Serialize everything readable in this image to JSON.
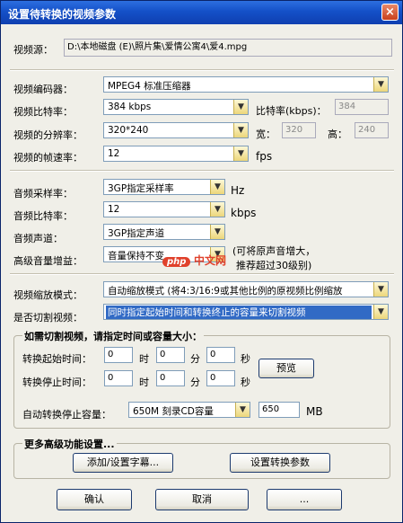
{
  "window": {
    "title": "设置待转换的视频参数",
    "close_label": "×"
  },
  "video": {
    "source_label": "视频源：",
    "source_value": "D:\\本地磁盘 (E)\\照片集\\爱情公寓4\\爱4.mpg",
    "encoder_label": "视频编码器：",
    "encoder_value": "MPEG4 标准压缩器",
    "bitrate_label": "视频比特率：",
    "bitrate_value": "384 kbps",
    "bitrate_kbps_label": "比特率(kbps)：",
    "bitrate_kbps_value": "384",
    "resolution_label": "视频的分辨率：",
    "resolution_value": "320*240",
    "width_label": "宽：",
    "width_value": "320",
    "height_label": "高：",
    "height_value": "240",
    "framerate_label": "视频的帧速率：",
    "framerate_value": "12",
    "framerate_unit": "fps"
  },
  "audio": {
    "samplerate_label": "音频采样率：",
    "samplerate_value": "3GP指定采样率",
    "samplerate_unit": "Hz",
    "bitrate_label": "音频比特率：",
    "bitrate_value": "12",
    "bitrate_unit": "kbps",
    "channel_label": "音频声道：",
    "channel_value": "3GP指定声道",
    "gain_label": "高级音量增益：",
    "gain_value": "音量保持不变",
    "gain_note_1": "(可将原声音增大，",
    "gain_note_2": "推荐超过30级别)"
  },
  "scale": {
    "label": "视频缩放模式：",
    "value": "自动缩放模式 (将4:3/16:9或其他比例的原视频比例缩放"
  },
  "cut": {
    "label": "是否切割视频：",
    "value": "同时指定起始时间和转换终止的容量来切割视频",
    "group_title": "如需切割视频，请指定时间或容量大小：",
    "start_label": "转换起始时间：",
    "stop_label": "转换停止时间：",
    "hour_unit": "时",
    "minute_unit": "分",
    "second_unit": "秒",
    "start_h": "0",
    "start_m": "0",
    "start_s": "0",
    "stop_h": "0",
    "stop_m": "0",
    "stop_s": "0",
    "preview_label": "预览",
    "capacity_label": "自动转换停止容量：",
    "capacity_value": "650M 刻录CD容量",
    "capacity_input": "650",
    "capacity_unit": "MB"
  },
  "advanced": {
    "group_title": "更多高级功能设置...",
    "subtitle_button": "添加/设置字幕...",
    "watermark_button": "设置转换参数"
  },
  "footer": {
    "ok_label": "确认",
    "cancel_label": "取消",
    "other_label": "..."
  },
  "watermark": {
    "logo_text": "php",
    "site_text": "中文网"
  },
  "colors": {
    "title_bar": "#1450c8",
    "selection_highlight": "#316ac5",
    "accent_orange": "#e0412b"
  },
  "icons": {
    "dropdown": "chevron-down-icon",
    "close": "close-icon"
  }
}
